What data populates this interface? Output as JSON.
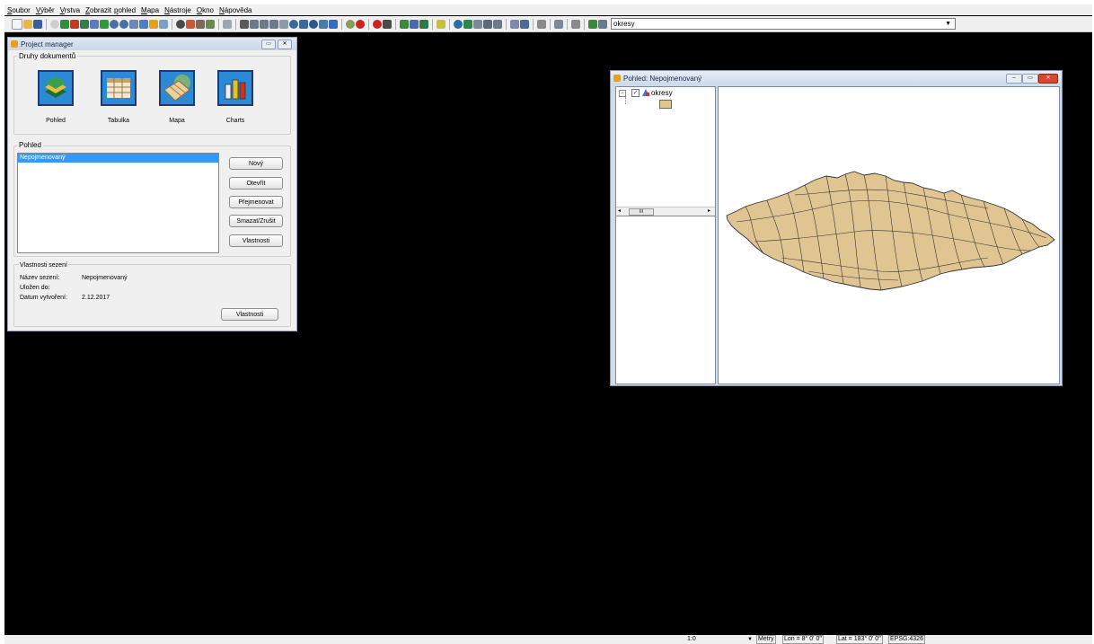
{
  "menubar": {
    "items": [
      "Soubor",
      "Výběr",
      "Vrstva",
      "Zobrazit",
      "pohled",
      "Mapa",
      "Nástroje",
      "Okno",
      "Nápověda"
    ]
  },
  "toolbar": {
    "layer_combo": "okresy"
  },
  "project_manager": {
    "title": "Project manager",
    "doc_types_label": "Druhy dokumentů",
    "doc_types": [
      "Pohled",
      "Tabulka",
      "Mapa",
      "Charts"
    ],
    "section_label": "Pohled",
    "list_items": [
      "Nepojmenovaný"
    ],
    "buttons": {
      "new": "Nový",
      "open": "Otevřít",
      "rename": "Přejmenovat",
      "delete": "Smazat/Zrušit",
      "properties": "Vlastnosti"
    },
    "session": {
      "label": "Vlastnosti sezení",
      "name_label": "Název sezení:",
      "name_value": "Nepojmenovaný",
      "saved_label": "Uložen do:",
      "date_label": "Datum vytvoření:",
      "date_value": "2.12.2017",
      "properties_button": "Vlastnosti"
    }
  },
  "view_window": {
    "title": "Pohled: Nepojmenovaný",
    "toc_layer": "okresy",
    "scroll_mid": "III",
    "layer_fill": "#e0c592",
    "layer_stroke": "#333333"
  },
  "statusbar": {
    "scale": "1:0",
    "units": "Metry",
    "lon": "Lon = 8° 0' 0\"",
    "lat": "Lat = 183° 0' 0\"",
    "epsg": "EPSG:4326"
  },
  "colors": {
    "selection": "#3399ff",
    "close_button": "#d9472d",
    "doc_icon_bg": "#2b8ad6"
  }
}
